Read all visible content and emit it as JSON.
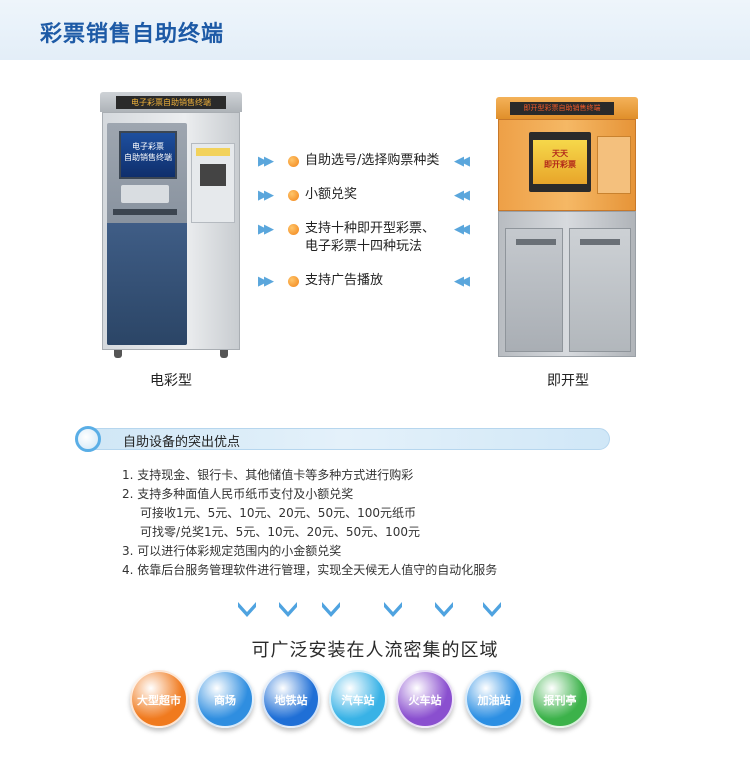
{
  "header": {
    "title": "彩票销售自助终端"
  },
  "kiosks": [
    {
      "sign": "电子彩票自助销售终端",
      "screen_line1": "电子彩票",
      "screen_line2": "自助销售终端",
      "caption": "电彩型"
    },
    {
      "sign": "即开型彩票自助销售终端",
      "screen_line1": "天天",
      "screen_line2": "即开彩票",
      "caption": "即开型"
    }
  ],
  "features": [
    "自助选号/选择购票种类",
    "小额兑奖",
    "支持十种即开型彩票、",
    "电子彩票十四种玩法",
    "支持广告播放"
  ],
  "advantages": {
    "title": "自助设备的突出优点",
    "lines": [
      "1. 支持现金、银行卡、其他储值卡等多种方式进行购彩",
      "2. 支持多种面值人民币纸币支付及小额兑奖",
      "可接收1元、5元、10元、20元、50元、100元纸币",
      "可找零/兑奖1元、5元、10元、20元、50元、100元",
      "3. 可以进行体彩规定范围内的小金额兑奖",
      "4. 依靠后台服务管理软件进行管理，实现全天候无人值守的自动化服务"
    ]
  },
  "areas": {
    "title": "可广泛安装在人流密集的区域",
    "items": [
      {
        "label": "大型超市",
        "color": "#f07a1e"
      },
      {
        "label": "商场",
        "color": "#2f8ee0"
      },
      {
        "label": "地铁站",
        "color": "#1f6fd6"
      },
      {
        "label": "汽车站",
        "color": "#38b2e6"
      },
      {
        "label": "火车站",
        "color": "#8a4fcf"
      },
      {
        "label": "加油站",
        "color": "#2c8fe3"
      },
      {
        "label": "报刊亭",
        "color": "#3cb24a"
      }
    ]
  },
  "colors": {
    "accent": "#1d5aa6",
    "arrow": "#5aa6dc",
    "dot": "#f28418"
  }
}
